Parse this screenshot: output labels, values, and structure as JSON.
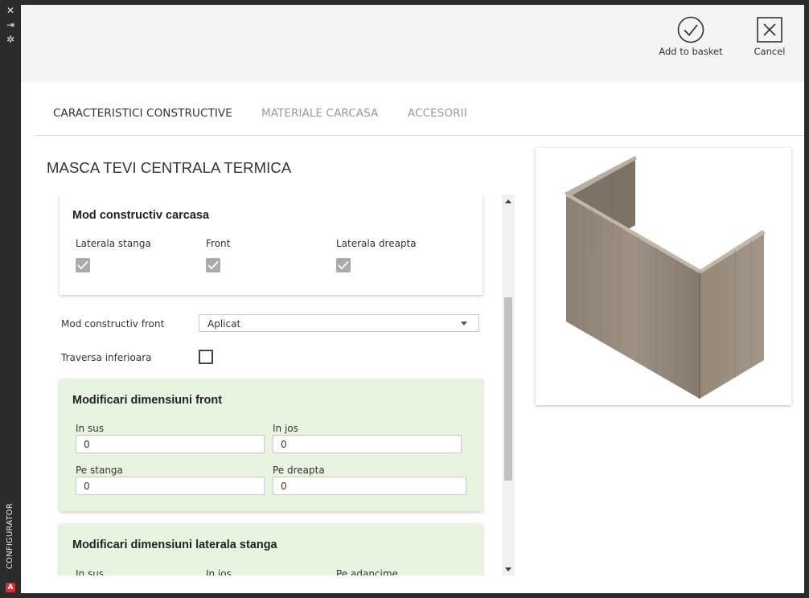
{
  "sidebar": {
    "icons": [
      "close-icon",
      "expand-icon",
      "settings-icon"
    ],
    "vertical_label": "CONFIGURATOR",
    "logo_letter": "A"
  },
  "toolbar": {
    "add_to_basket_label": "Add to basket",
    "cancel_label": "Cancel"
  },
  "tabs": [
    {
      "label": "CARACTERISTICI CONSTRUCTIVE",
      "active": true
    },
    {
      "label": "MATERIALE CARCASA",
      "active": false
    },
    {
      "label": "ACCESORII",
      "active": false
    }
  ],
  "page_title": "MASCA TEVI CENTRALA TERMICA",
  "mod_carcasa": {
    "heading": "Mod constructiv carcasa",
    "options": [
      {
        "label": "Laterala stanga",
        "checked": true
      },
      {
        "label": "Front",
        "checked": true
      },
      {
        "label": "Laterala dreapta",
        "checked": true
      }
    ]
  },
  "mod_front": {
    "label": "Mod constructiv front",
    "value": "Aplicat"
  },
  "traversa": {
    "label": "Traversa inferioara",
    "checked": false
  },
  "dim_front": {
    "heading": "Modificari dimensiuni front",
    "fields": [
      {
        "label": "In sus",
        "value": "0"
      },
      {
        "label": "In jos",
        "value": "0"
      },
      {
        "label": "Pe stanga",
        "value": "0"
      },
      {
        "label": "Pe dreapta",
        "value": "0"
      }
    ]
  },
  "dim_laterala_stanga": {
    "heading": "Modificari dimensiuni laterala stanga",
    "fields": [
      {
        "label": "In sus"
      },
      {
        "label": "In jos"
      },
      {
        "label": "Pe adancime"
      }
    ]
  },
  "colors": {
    "accent_green_panel": "#e8f4df",
    "checkbox_disabled": "#ababab",
    "wood_light": "#9b8e80",
    "wood_dark": "#6f655b"
  }
}
